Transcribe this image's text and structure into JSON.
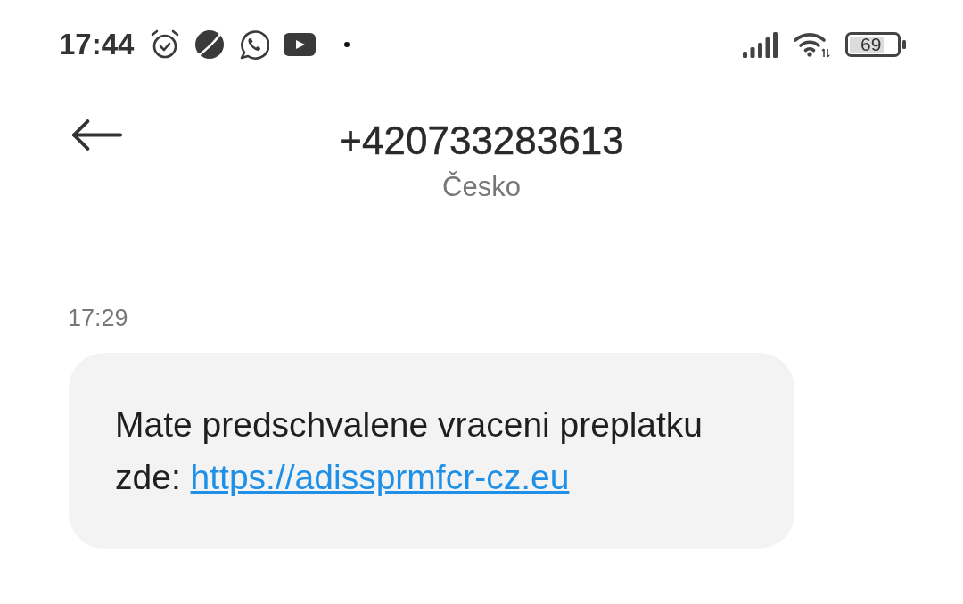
{
  "status_bar": {
    "time": "17:44",
    "battery": "69"
  },
  "header": {
    "title": "+420733283613",
    "subtitle": "Česko"
  },
  "messages": [
    {
      "time": "17:29",
      "text": "Mate predschvalene vraceni preplatku zde:",
      "link": "https://adissprmfcr-cz.eu"
    }
  ]
}
